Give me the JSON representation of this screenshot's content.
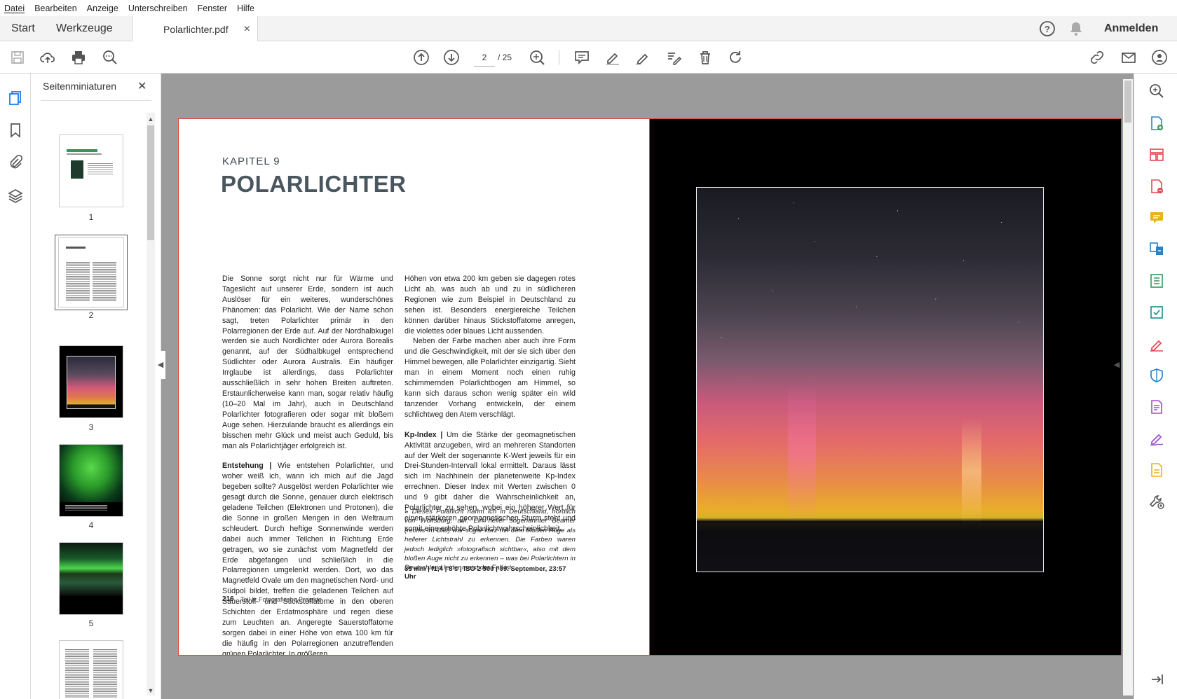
{
  "menu": [
    "Datei",
    "Bearbeiten",
    "Anzeige",
    "Unterschreiben",
    "Fenster",
    "Hilfe"
  ],
  "tabs": {
    "start": "Start",
    "tools": "Werkzeuge",
    "document": "Polarlichter.pdf",
    "close": "×"
  },
  "header": {
    "signin": "Anmelden"
  },
  "toolbar": {
    "page_current": "2",
    "page_total": "/ 25"
  },
  "thumbnails": {
    "title": "Seitenminiaturen",
    "close": "✕",
    "pages": [
      "1",
      "2",
      "3",
      "4",
      "5"
    ]
  },
  "page": {
    "chapter": "KAPITEL 9",
    "title": "POLARLICHTER",
    "col1_p1": "Die Sonne sorgt nicht nur für Wärme und Tageslicht auf unserer Erde, sondern ist auch Auslöser für ein weiteres, wunderschönes Phänomen: das Polarlicht. Wie der Name schon sagt, treten Polarlichter primär in den Polarregionen der Erde auf. Auf der Nordhalbkugel werden sie auch Nordlichter oder Aurora Borealis genannt, auf der Südhalbkugel entsprechend Südlichter oder Aurora Australis. Ein häufiger Irrglaube ist allerdings, dass Polarlichter ausschließlich in sehr hohen Breiten auftreten. Erstaunlicherweise kann man, sogar relativ häufig (10–20 Mal im Jahr), auch in Deutschland Polarlichter fotografieren oder sogar mit bloßem Auge sehen. Hierzulande braucht es allerdings ein bisschen mehr Glück und meist auch Geduld, bis man als Polarlichtjäger erfolgreich ist.",
    "col1_p2_head": "Entstehung |",
    "col1_p2": " Wie entstehen Polarlichter, und woher weiß ich, wann ich mich auf die Jagd begeben sollte? Ausgelöst werden Polarlichter wie gesagt durch die Sonne, genauer durch elektrisch geladene Teilchen (Elektronen und Protonen), die die Sonne in großen Mengen in den Weltraum schleudert. Durch heftige Sonnenwinde werden dabei auch immer Teilchen in Richtung Erde getragen, wo sie zunächst vom Magnetfeld der Erde abgefangen und schließlich in die Polarregionen umgelenkt werden. Dort, wo das Magnetfeld Ovale um den magnetischen Nord- und Südpol bildet, treffen die geladenen Teilchen auf Sauerstoff- und Stickstoffatome in den oberen Schichten der Erdatmosphäre und regen diese zum Leuchten an. Angeregte Sauerstoffatome sorgen dabei in einer Höhe von etwa 100 km für die häufig in den Polarregionen anzutreffenden grünen Polarlichter. In größeren",
    "col2_p1": "Höhen von etwa 200 km geben sie dagegen rotes Licht ab, was auch ab und zu in südlicheren Regionen wie zum Beispiel in Deutschland zu sehen ist. Besonders energiereiche Teilchen können darüber hinaus Stickstoffatome anregen, die violettes oder blaues Licht aussenden.",
    "col2_p2": "Neben der Farbe machen aber auch ihre Form und die Geschwindigkeit, mit der sie sich über den Himmel bewegen, alle Polarlichter einzigartig. Sieht man in einem Moment noch einen ruhig schimmernden Polarlichtbogen am Himmel, so kann sich daraus schon wenig später ein wild tanzender Vorhang entwickeln, der einem schlichtweg den Atem verschlägt.",
    "col2_p3_head": "Kp-Index |",
    "col2_p3": " Um die Stärke der geomagnetischen Aktivität anzugeben, wird an mehreren Standorten auf der Welt der sogenannte K-Wert jeweils für ein Drei-Stunden-Intervall lokal ermittelt. Daraus lässt sich im Nachhinein der planetenweite Kp-Index errechnen. Dieser Index mit Werten zwischen 0 und 9 gibt daher die Wahrscheinlichkeit an, Polarlichter zu sehen, wobei ein höherer Wert für einen stärkeren geomagnetischen Sturm steht und somit eine erhöhte Polarlichtwahrscheinlichkeit.",
    "caption": "Dieses Polarlicht nahm ich in Deutschland, nördlich von Wolfsburg, auf. Ein heller sogenannter Beamer (rechts im Bild) war sogar kurz mit dem bloßen Auge als hellerer Lichtstrahl zu erkennen. Die Farben waren jedoch lediglich »fotografisch sichtbar«, also mit dem bloßen Auge nicht zu erkennen – was bei Polarlichtern in Deutschland leider meist der Fall ist.",
    "caption_marker": "»",
    "exif": "35 mm | f1,4 | 8 s | ISO 2 500 | 09. September, 23:57 Uhr",
    "page_number": "216",
    "footer": "Teil II: Fotografische Projekte"
  },
  "colors": {
    "accent": "#e2403a",
    "link_blue": "#1473e6",
    "purple": "#9b4fd1",
    "green": "#2e9b5a",
    "red": "#e34850",
    "yellow": "#e8b21a"
  }
}
